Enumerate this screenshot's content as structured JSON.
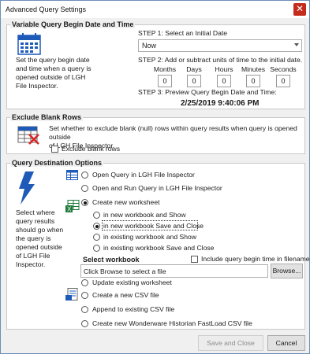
{
  "window": {
    "title": "Advanced Query Settings",
    "close_glyph": "✕"
  },
  "begin_group": {
    "title": "Variable Query Begin Date and Time",
    "icon": "calendar-icon",
    "description_lines": [
      "Set the query begin date",
      "and time when a query is",
      "opened outside of LGH",
      "File Inspector."
    ],
    "step1": "STEP 1: Select an Initial Date",
    "initial_date": "Now",
    "step2": "STEP 2: Add or subtract units of time to the initial date.",
    "units": [
      {
        "label": "Months",
        "value": "0"
      },
      {
        "label": "Days",
        "value": "0"
      },
      {
        "label": "Hours",
        "value": "0"
      },
      {
        "label": "Minutes",
        "value": "0"
      },
      {
        "label": "Seconds",
        "value": "0"
      }
    ],
    "step3": "STEP 3: Preview Query Begin Date and Time:",
    "preview": "2/25/2019 9:40:06 PM"
  },
  "blank_group": {
    "title": "Exclude Blank Rows",
    "icon": "table-delete-icon",
    "description_lines": [
      "Set whether to exclude blank (null) rows within query results when query is opened outside",
      "of LGH File Inspector."
    ],
    "checkbox_label": "Exclude blank rows",
    "checked": false
  },
  "dest_group": {
    "title": "Query Destination Options",
    "icon": "lightning-icon",
    "description_lines": [
      "Select where",
      "query results",
      "should go when",
      "the query is",
      "opened outside",
      "of LGH File",
      "Inspector."
    ],
    "options": {
      "open_inspector": "Open Query in LGH File Inspector",
      "open_run_inspector": "Open and Run Query in LGH File Inspector",
      "create_worksheet": "Create new worksheet",
      "new_wb_show": "in new workbook and Show",
      "new_wb_save_close": "in new workbook Save and Close",
      "existing_wb_show": "in existing workbook and Show",
      "existing_wb_save_close": "in existing workbook Save and Close",
      "update_worksheet": "Update existing worksheet",
      "create_csv": "Create a new CSV file",
      "append_csv": "Append to existing CSV file",
      "create_fastload": "Create new Wonderware Historian FastLoad CSV file"
    },
    "select_workbook_label": "Select workbook",
    "include_begin_label": "Include query begin time in filename",
    "workbook_placeholder": "Click Browse to select a file",
    "browse_label": "Browse..."
  },
  "footer": {
    "save_close": "Save and Close",
    "cancel": "Cancel"
  },
  "colors": {
    "accent_blue": "#1e5bb8",
    "close_red": "#c42b1c",
    "excel_green": "#1f7a3a"
  }
}
